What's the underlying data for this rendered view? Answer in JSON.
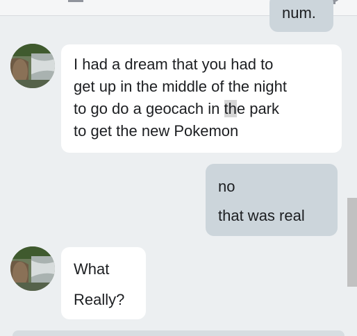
{
  "chat": {
    "partial_message_text": "num.",
    "messages": [
      {
        "sender": "contact",
        "lines": [
          "I had a dream that you had to",
          "get up in the middle of the night",
          "to go do a geocach in the park",
          "to get the new Pokemon"
        ],
        "line3_before_cursor": "to go do a geocach in ",
        "line3_cursor": "th",
        "line3_after_cursor": "e park"
      },
      {
        "sender": "me",
        "lines": [
          "no",
          "that was real"
        ]
      },
      {
        "sender": "contact",
        "lines": [
          "What",
          "Really?"
        ]
      }
    ]
  },
  "colors": {
    "background": "#eceff1",
    "incoming_bubble": "#ffffff",
    "outgoing_bubble": "#ccd5db",
    "text": "#1c1e21",
    "scrollbar_thumb": "#c1c1c1"
  }
}
